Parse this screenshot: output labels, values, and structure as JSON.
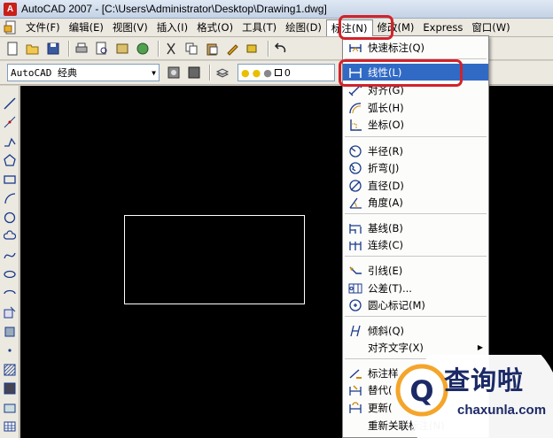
{
  "window": {
    "title": "AutoCAD 2007 - [C:\\Users\\Administrator\\Desktop\\Drawing1.dwg]"
  },
  "menubar": {
    "items": [
      "文件(F)",
      "编辑(E)",
      "视图(V)",
      "插入(I)",
      "格式(O)",
      "工具(T)",
      "绘图(D)",
      "标注(N)",
      "修改(M)",
      "Express",
      "窗口(W)"
    ],
    "active": "标注(N)"
  },
  "toolbar2": {
    "workspace_value": "AutoCAD 经典",
    "layer_value": "0"
  },
  "dimension_menu": {
    "items": [
      {
        "label": "快速标注(Q)",
        "icon": "quick-dim-icon"
      },
      {
        "label": "线性(L)",
        "icon": "linear-dim-icon",
        "highlighted": true
      },
      {
        "label": "对齐(G)",
        "icon": "aligned-dim-icon"
      },
      {
        "label": "弧长(H)",
        "icon": "arc-length-icon"
      },
      {
        "label": "坐标(O)",
        "icon": "ordinate-icon"
      },
      {
        "label": "半径(R)",
        "icon": "radius-icon"
      },
      {
        "label": "折弯(J)",
        "icon": "jogged-icon"
      },
      {
        "label": "直径(D)",
        "icon": "diameter-icon"
      },
      {
        "label": "角度(A)",
        "icon": "angular-icon"
      },
      {
        "label": "基线(B)",
        "icon": "baseline-icon"
      },
      {
        "label": "连续(C)",
        "icon": "continue-icon"
      },
      {
        "label": "引线(E)",
        "icon": "leader-icon"
      },
      {
        "label": "公差(T)...",
        "icon": "tolerance-icon"
      },
      {
        "label": "圆心标记(M)",
        "icon": "center-mark-icon"
      },
      {
        "label": "倾斜(Q)",
        "icon": "oblique-icon"
      },
      {
        "label": "对齐文字(X)",
        "icon": "",
        "submenu": true
      },
      {
        "label": "标注样",
        "icon": "dim-style-icon"
      },
      {
        "label": "替代(",
        "icon": "override-icon"
      },
      {
        "label": "更新(",
        "icon": "update-icon"
      },
      {
        "label": "重新关联标注(N)",
        "icon": ""
      }
    ]
  },
  "watermark": {
    "text": "查询啦",
    "subtext": "chaxunla.com"
  },
  "colors": {
    "highlight": "#316ac5",
    "annotation_red": "#d2232a",
    "canvas": "#000000"
  }
}
